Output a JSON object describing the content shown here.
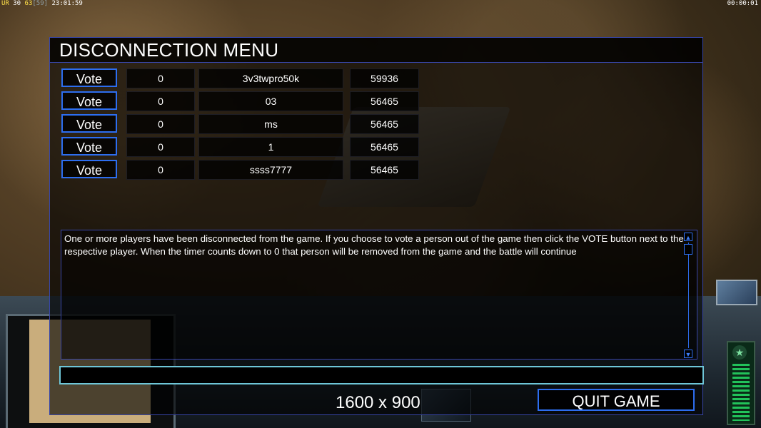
{
  "status_bar": {
    "ur_label": "UR",
    "ur_value": "30",
    "fps": "63",
    "fps_bracket": "[59]",
    "clock": "23:01:59",
    "game_timer": "00:00:01"
  },
  "dialog": {
    "title": "DISCONNECTION MENU",
    "players": [
      {
        "vote_label": "Vote",
        "votes": "0",
        "name": "3v3twpro50k",
        "timeout": "59936"
      },
      {
        "vote_label": "Vote",
        "votes": "0",
        "name": "03",
        "timeout": "56465"
      },
      {
        "vote_label": "Vote",
        "votes": "0",
        "name": "ms",
        "timeout": "56465"
      },
      {
        "vote_label": "Vote",
        "votes": "0",
        "name": "1",
        "timeout": "56465"
      },
      {
        "vote_label": "Vote",
        "votes": "0",
        "name": "ssss7777",
        "timeout": "56465"
      }
    ],
    "message": "One or more players have been disconnected from the game. If you choose to vote a person out of the game then click the VOTE button next to the respective player. When the timer counts down to 0 that person will be removed from the game and the battle will continue",
    "chat_value": "",
    "resolution": "1600 x 900",
    "quit_label": "QUIT GAME"
  },
  "icons": {
    "scroll_up": "scroll-up-arrow-icon",
    "scroll_down": "scroll-down-arrow-icon"
  },
  "colors": {
    "accent_border": "#2d6ef0",
    "chat_border": "#6ec6d8",
    "ur_text": "#ffe04a"
  }
}
